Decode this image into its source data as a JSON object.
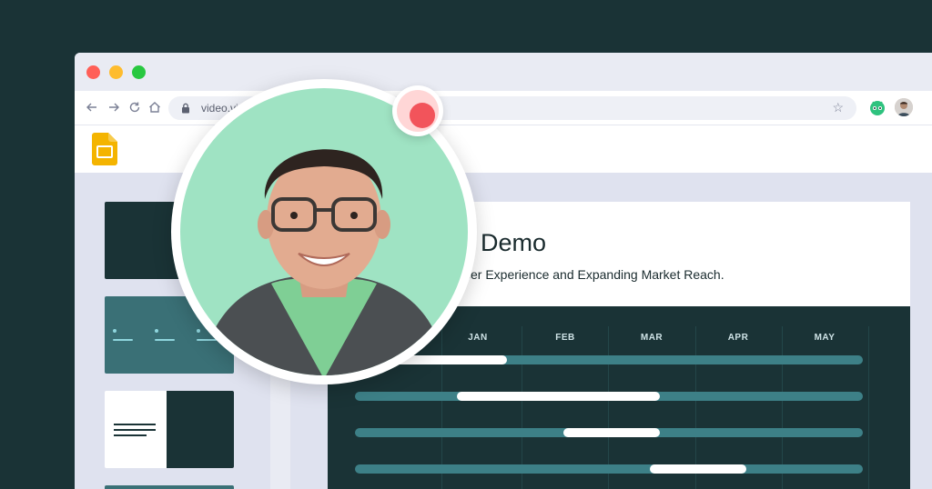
{
  "browser": {
    "url": "video.vid",
    "colors": {
      "close": "#ff5f57",
      "minimize": "#febc2e",
      "maximize": "#28c840"
    },
    "icons": [
      "back-arrow-icon",
      "forward-arrow-icon",
      "reload-icon",
      "home-icon",
      "lock-icon",
      "star-icon",
      "extension-icon",
      "profile-avatar"
    ]
  },
  "app": {
    "logo_icon": "google-slides-icon"
  },
  "slide": {
    "title": "Demo",
    "subtitle": "ser Experience and Expanding Market Reach.",
    "months": [
      "JAN",
      "FEB",
      "MAR",
      "APR",
      "MAY"
    ]
  },
  "timeline": {
    "bars": [
      {
        "start": 0.0,
        "end": 0.3
      },
      {
        "start": 0.2,
        "end": 0.6
      },
      {
        "start": 0.41,
        "end": 0.6
      },
      {
        "start": 0.58,
        "end": 0.77
      }
    ]
  },
  "recorder": {
    "color": "#f2545b",
    "icon": "record-icon"
  }
}
